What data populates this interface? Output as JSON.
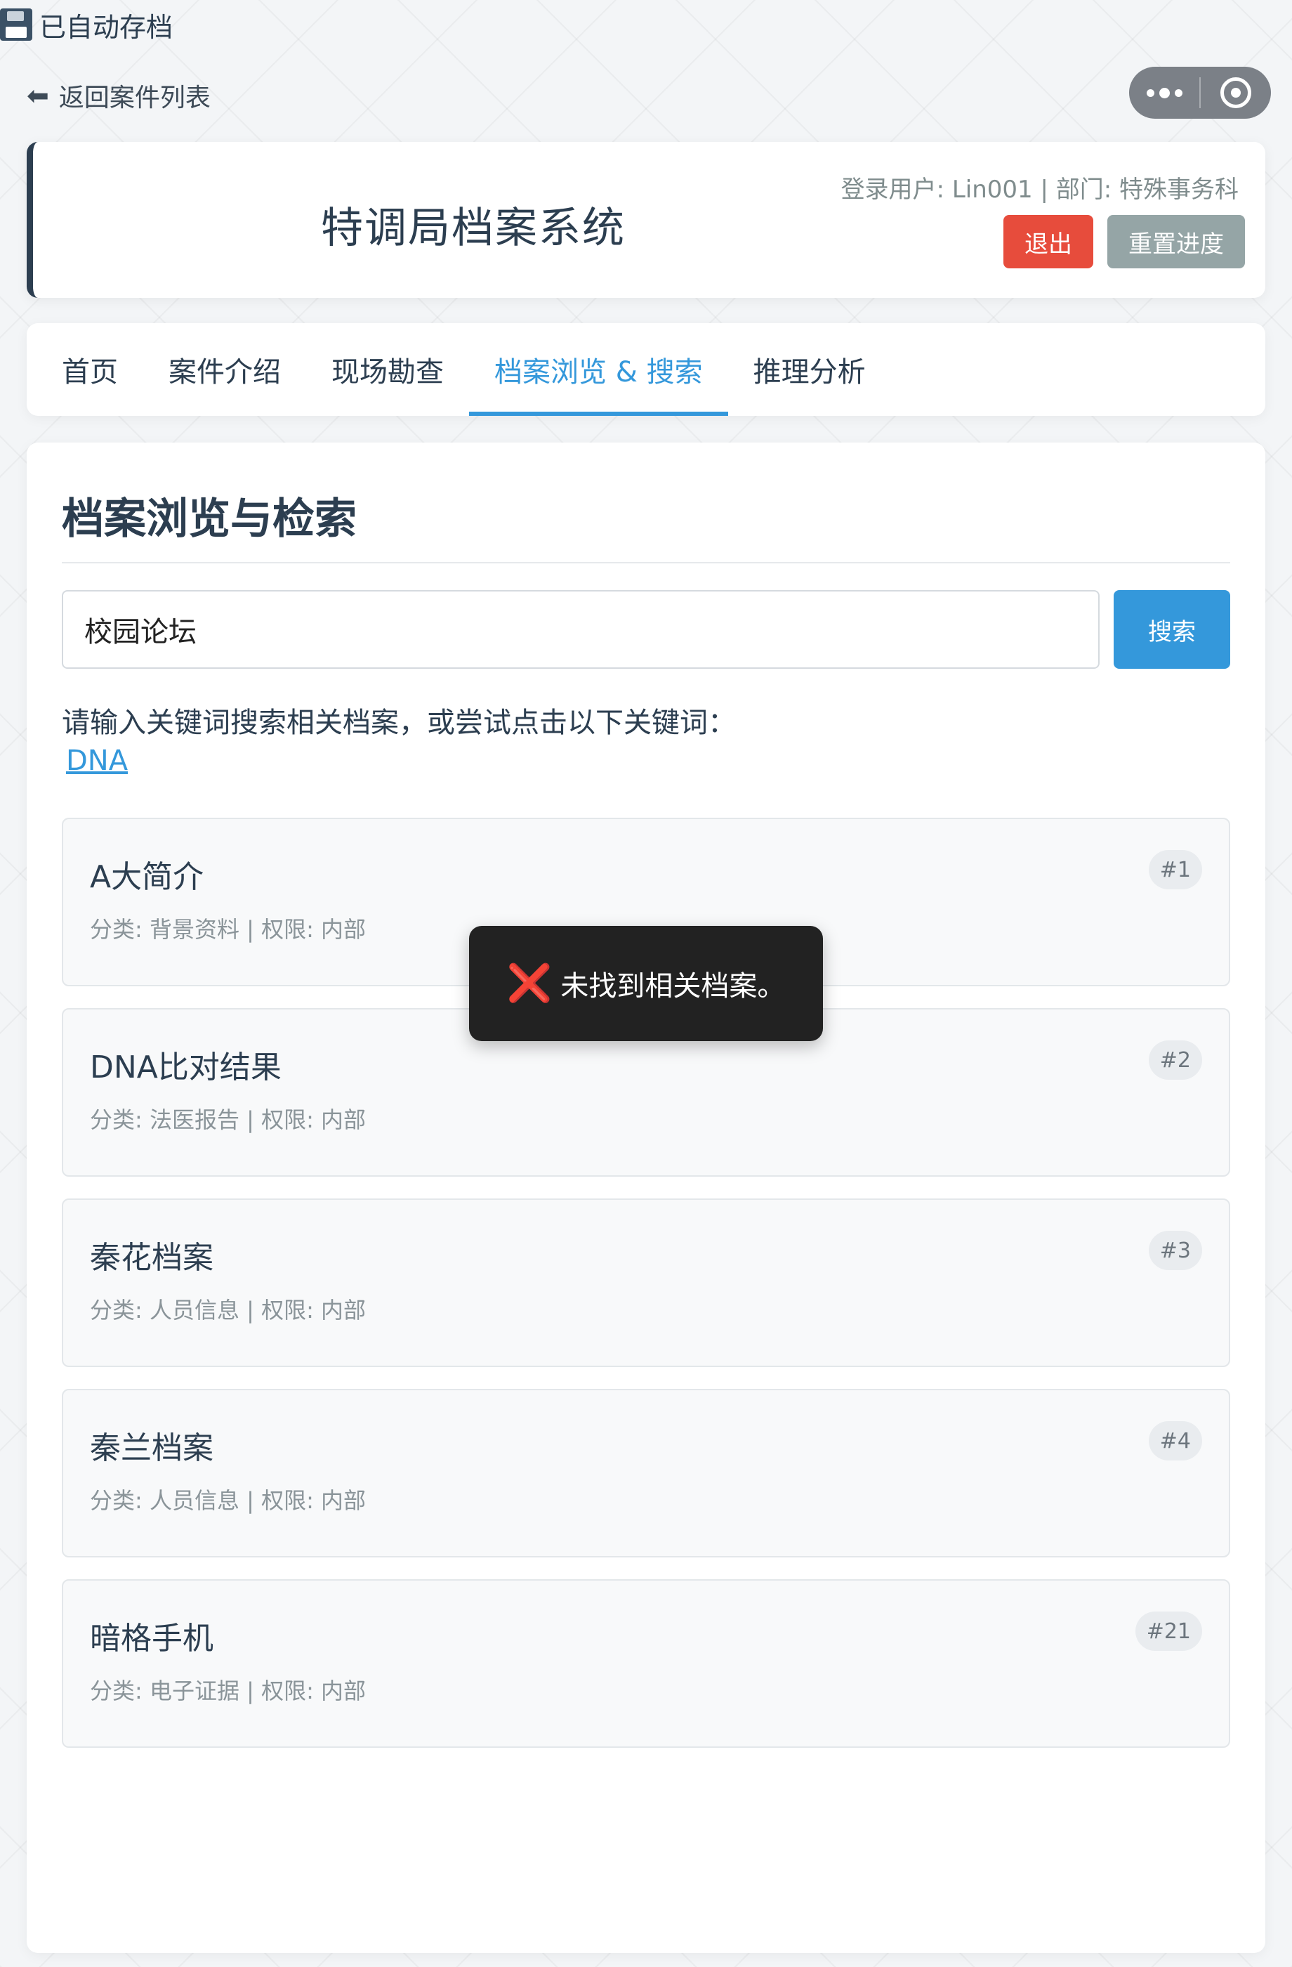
{
  "autosave": {
    "label": "已自动存档",
    "icon": "floppy-disk-icon"
  },
  "nav": {
    "back_label": "返回案件列表",
    "back_icon": "arrow-left-icon"
  },
  "capsule": {
    "more_icon": "more-dots-icon",
    "close_icon": "target-circle-icon"
  },
  "header": {
    "title": "特调局档案系统",
    "user_info": "登录用户: Lin001 | 部门: 特殊事务科",
    "logout_label": "退出",
    "reset_label": "重置进度"
  },
  "tabs": [
    {
      "label": "首页",
      "active": false
    },
    {
      "label": "案件介绍",
      "active": false
    },
    {
      "label": "现场勘查",
      "active": false
    },
    {
      "label": "档案浏览 & 搜索",
      "active": true
    },
    {
      "label": "推理分析",
      "active": false
    }
  ],
  "main": {
    "title": "档案浏览与检索",
    "search_value": "校园论坛",
    "search_button": "搜索",
    "hint": "请输入关键词搜索相关档案，或尝试点击以下关键词：",
    "keyword": "DNA"
  },
  "records": [
    {
      "title": "A大简介",
      "meta": "分类: 背景资料 | 权限: 内部",
      "id": "#1"
    },
    {
      "title": "DNA比对结果",
      "meta": "分类: 法医报告 | 权限: 内部",
      "id": "#2"
    },
    {
      "title": "秦花档案",
      "meta": "分类: 人员信息 | 权限: 内部",
      "id": "#3"
    },
    {
      "title": "秦兰档案",
      "meta": "分类: 人员信息 | 权限: 内部",
      "id": "#4"
    },
    {
      "title": "暗格手机",
      "meta": "分类: 电子证据 | 权限: 内部",
      "id": "#21"
    }
  ],
  "toast": {
    "icon": "❌",
    "message": "未找到相关档案。"
  },
  "colors": {
    "accent": "#3498db",
    "danger": "#e74c3c",
    "neutral": "#95a5a6",
    "header_text": "#2c3e50"
  }
}
